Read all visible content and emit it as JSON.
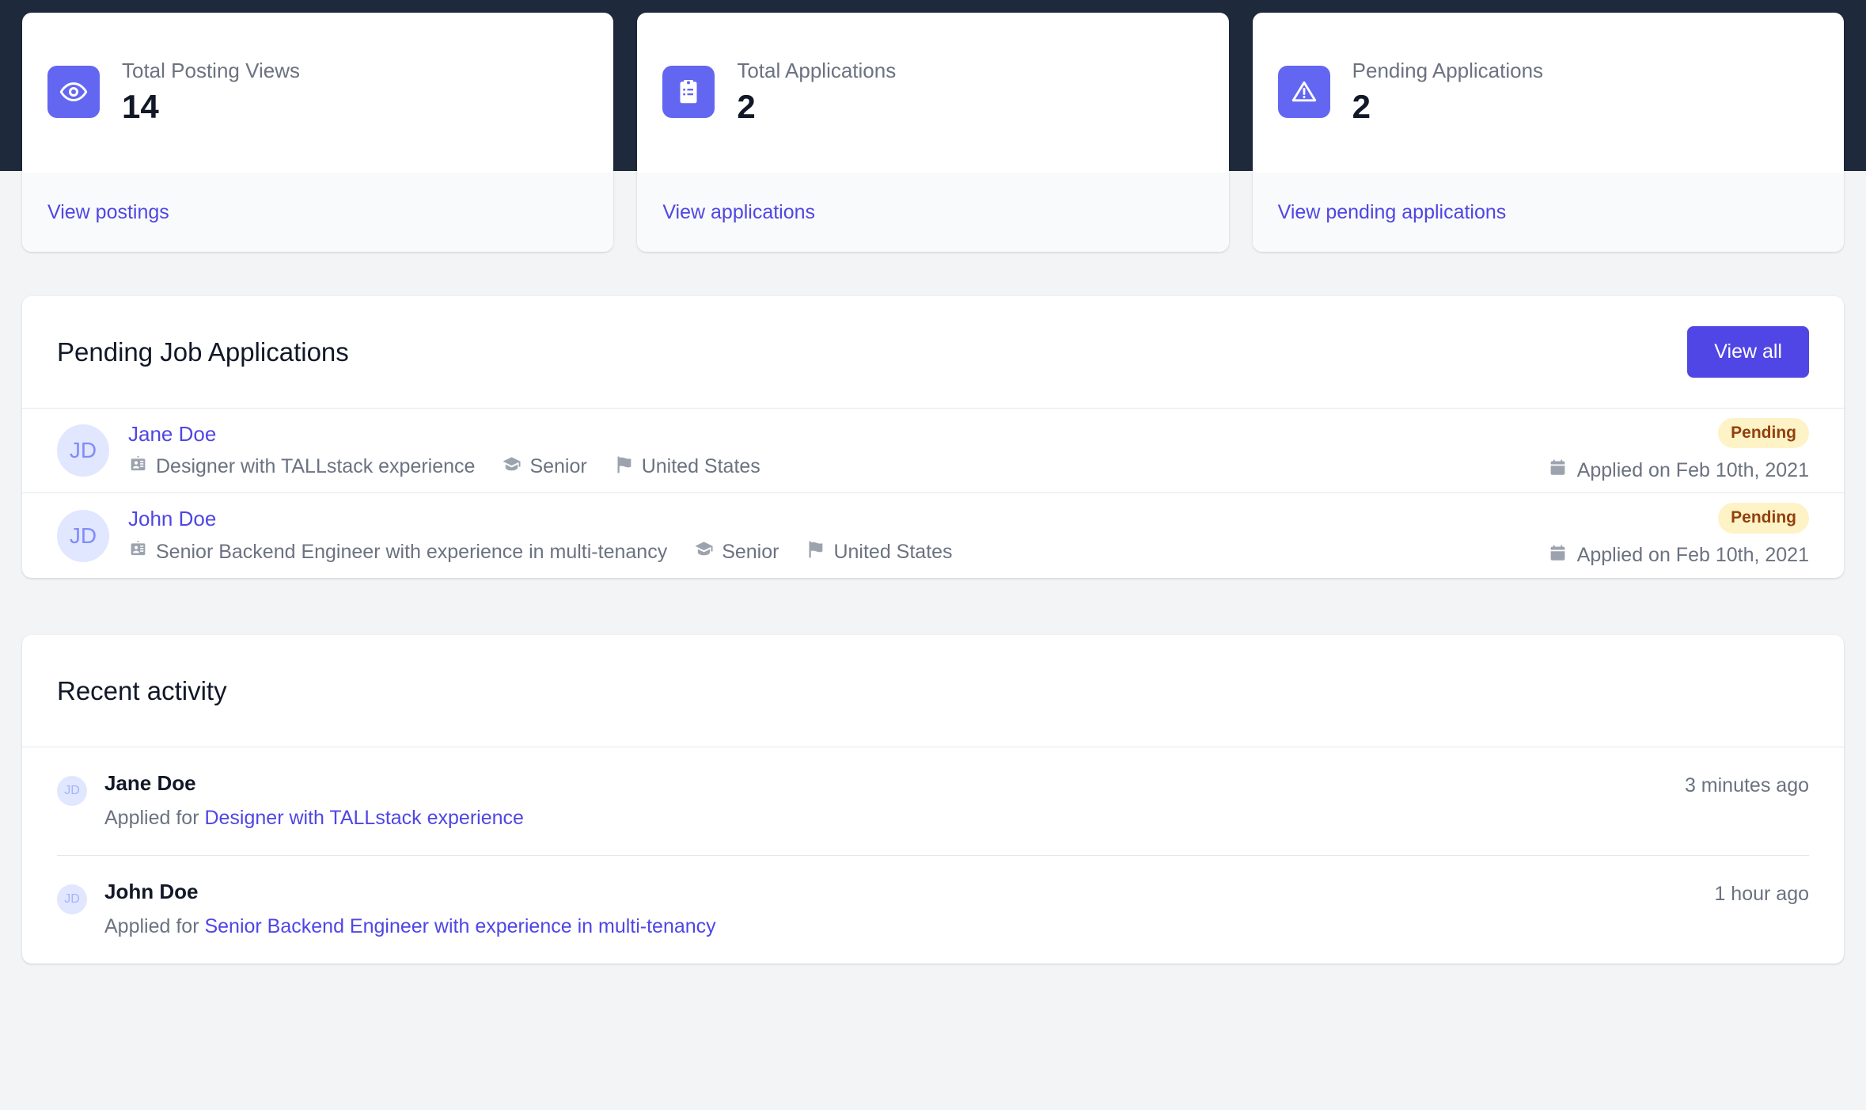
{
  "theme": {
    "accent": "#4F46E5",
    "icon_tile": "#6366F1",
    "dark_band": "#1E293B",
    "page_bg": "#F3F4F6",
    "badge_bg": "#FEF3C7",
    "badge_text": "#92400E",
    "avatar_bg": "#E0E7FF"
  },
  "stats": [
    {
      "icon": "eye-icon",
      "label": "Total Posting Views",
      "value": "14",
      "link": "View postings"
    },
    {
      "icon": "clipboard-list-icon",
      "label": "Total Applications",
      "value": "2",
      "link": "View applications"
    },
    {
      "icon": "exclamation-triangle-icon",
      "label": "Pending Applications",
      "value": "2",
      "link": "View pending applications"
    }
  ],
  "pending_panel": {
    "title": "Pending Job Applications",
    "view_all_label": "View all",
    "rows": [
      {
        "initials": "JD",
        "name": "Jane Doe",
        "position": "Designer with TALLstack experience",
        "level": "Senior",
        "location": "United States",
        "status": "Pending",
        "applied": "Applied on Feb 10th, 2021"
      },
      {
        "initials": "JD",
        "name": "John Doe",
        "position": "Senior Backend Engineer with experience in multi-tenancy",
        "level": "Senior",
        "location": "United States",
        "status": "Pending",
        "applied": "Applied on Feb 10th, 2021"
      }
    ]
  },
  "activity_panel": {
    "title": "Recent activity",
    "rows": [
      {
        "initials": "JD",
        "name": "Jane Doe",
        "prefix": "Applied for ",
        "link": "Designer with TALLstack experience",
        "time": "3 minutes ago"
      },
      {
        "initials": "JD",
        "name": "John Doe",
        "prefix": "Applied for ",
        "link": "Senior Backend Engineer with experience in multi-tenancy",
        "time": "1 hour ago"
      }
    ]
  }
}
